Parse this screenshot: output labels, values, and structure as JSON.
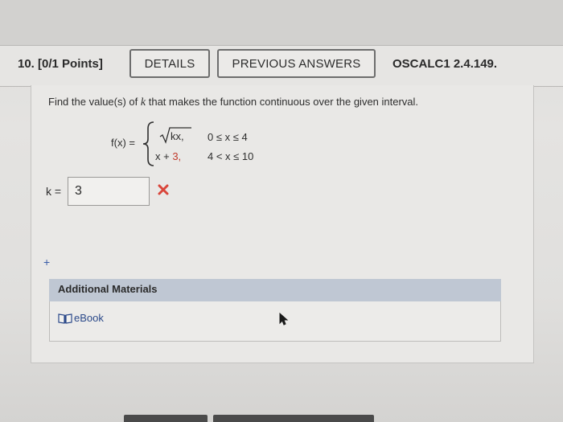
{
  "header": {
    "question_number": "10. [0/1 Points]",
    "details_label": "DETAILS",
    "previous_answers_label": "PREVIOUS ANSWERS",
    "reference_code": "OSCALC1 2.4.149."
  },
  "question": {
    "prompt_before": "Find the value(s) of ",
    "prompt_var": "k",
    "prompt_after": " that makes the function continuous over the given interval.",
    "function_label": "f(x) =",
    "case1_expr": "kx,",
    "case1_cond": "0 ≤ x ≤ 4",
    "case2_expr_prefix": "x + ",
    "case2_expr_num": "3,",
    "case2_cond": "4 < x ≤ 10"
  },
  "answer": {
    "label": "k =",
    "value": "3",
    "status_icon": "incorrect-x-icon"
  },
  "plus_symbol": "+",
  "additional_materials": {
    "title": "Additional Materials",
    "ebook_label": "eBook",
    "ebook_icon": "book-icon"
  },
  "colors": {
    "incorrect": "#d9463b",
    "materials_header": "#bfc7d3",
    "link": "#2c4a8a"
  }
}
